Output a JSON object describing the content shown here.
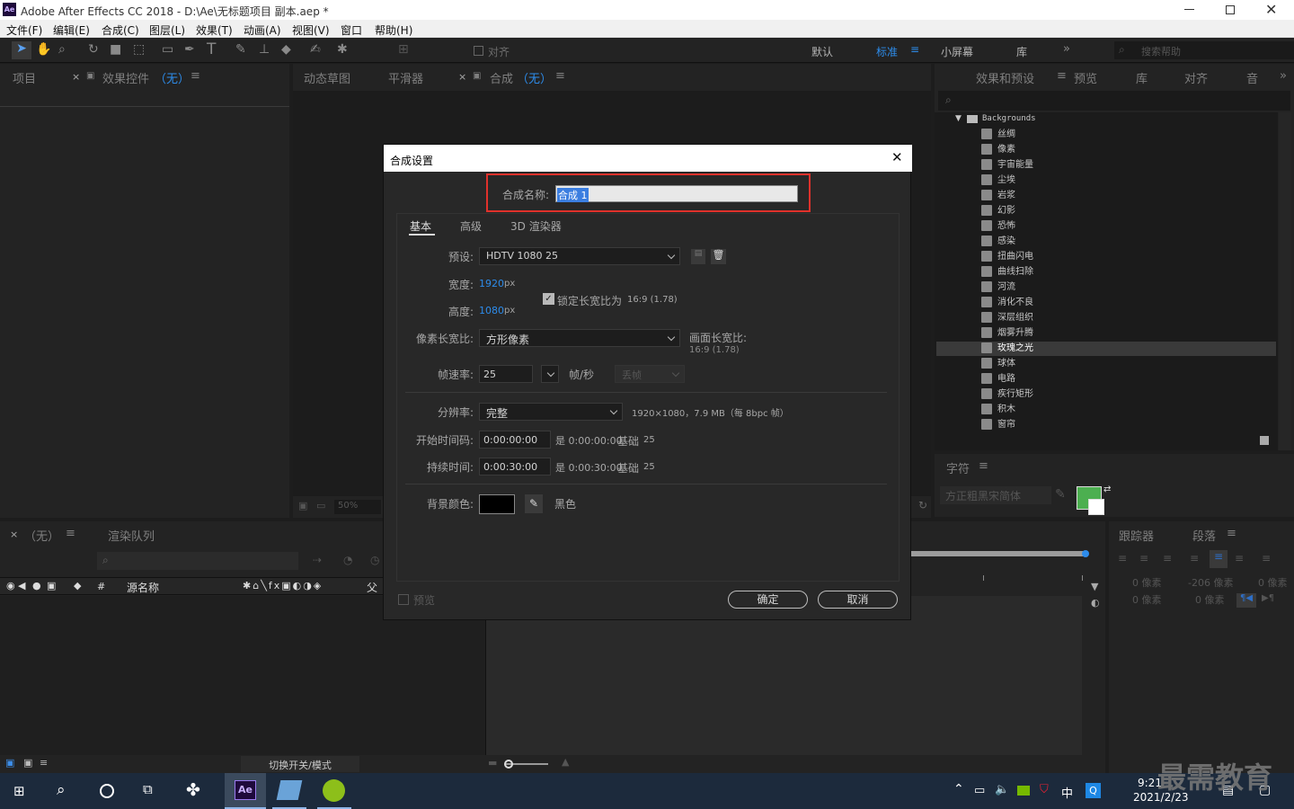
{
  "window": {
    "title": "Adobe After Effects CC 2018 - D:\\Ae\\无标题项目 副本.aep *",
    "app_icon": "Ae"
  },
  "menu": [
    "文件(F)",
    "编辑(E)",
    "合成(C)",
    "图层(L)",
    "效果(T)",
    "动画(A)",
    "视图(V)",
    "窗口",
    "帮助(H)"
  ],
  "toolbar": {
    "align": "对齐",
    "workspaces": [
      "默认",
      "标准",
      "小屏幕",
      "库"
    ],
    "search_placeholder": "搜索帮助"
  },
  "panels": {
    "project": "项目",
    "effect_controls": "效果控件",
    "effect_controls_target": "（无）",
    "flowchart": "动态草图",
    "smoother": "平滑器",
    "comp": "合成",
    "comp_target": "（无）",
    "effects_presets": "效果和预设",
    "preview": "预览",
    "library": "库",
    "align": "对齐",
    "audio": "音",
    "character": "字符",
    "font": "方正粗黑宋简体",
    "tracker": "跟踪器",
    "paragraph": "段落",
    "zoom": "50%",
    "timeline_target": "（无）",
    "render_queue": "渲染队列",
    "col_source": "源名称",
    "col_num": "#",
    "col_parent": "父",
    "toggle_modes": "切换开关/模式",
    "para_values": [
      "0 像素",
      "-206 像素",
      "0 像素",
      "0 像素",
      "0 像素"
    ]
  },
  "library": {
    "folder": "Backgrounds",
    "items": [
      "丝绸",
      "像素",
      "宇宙能量",
      "尘埃",
      "岩浆",
      "幻影",
      "恐怖",
      "感染",
      "扭曲闪电",
      "曲线扫除",
      "河流",
      "消化不良",
      "深层组织",
      "烟雾升腾",
      "玫瑰之光",
      "球体",
      "电路",
      "疾行矩形",
      "积木",
      "窗帘"
    ],
    "selected": "玫瑰之光"
  },
  "dialog": {
    "title": "合成设置",
    "name_label": "合成名称:",
    "name_value": "合成 1",
    "tabs": [
      "基本",
      "高级",
      "3D 渲染器"
    ],
    "preset_label": "预设:",
    "preset_value": "HDTV 1080 25",
    "width_label": "宽度:",
    "width_value": "1920",
    "px1": "px",
    "height_label": "高度:",
    "height_value": "1080",
    "px2": "px",
    "lock_label": "锁定长宽比为",
    "lock_ratio": "16:9 (1.78)",
    "par_label": "像素长宽比:",
    "par_value": "方形像素",
    "frame_ar_label": "画面长宽比:",
    "frame_ar_value": "16:9 (1.78)",
    "fps_label": "帧速率:",
    "fps_value": "25",
    "fps_unit": "帧/秒",
    "drop_frame": "丢帧",
    "res_label": "分辨率:",
    "res_value": "完整",
    "res_info": "1920×1080，7.9 MB（每 8bpc 帧）",
    "start_label": "开始时间码:",
    "start_value": "0:00:00:00",
    "start_info": "是 0:00:00:00",
    "start_base": "基础",
    "start_base_val": "25",
    "dur_label": "持续时间:",
    "dur_value": "0:00:30:00",
    "dur_info": "是 0:00:30:00",
    "dur_base": "基础",
    "dur_base_val": "25",
    "bg_label": "背景颜色:",
    "bg_name": "黑色",
    "bg_color": "#000000",
    "preview_label": "预览",
    "ok": "确定",
    "cancel": "取消"
  },
  "taskbar": {
    "time": "9:21",
    "date": "2021/2/23",
    "ime": "中",
    "watermark": "最需教育"
  },
  "colors": {
    "accent": "#2d8ceb",
    "highlight": "#e0312b",
    "char_fill": "#4caf50"
  }
}
